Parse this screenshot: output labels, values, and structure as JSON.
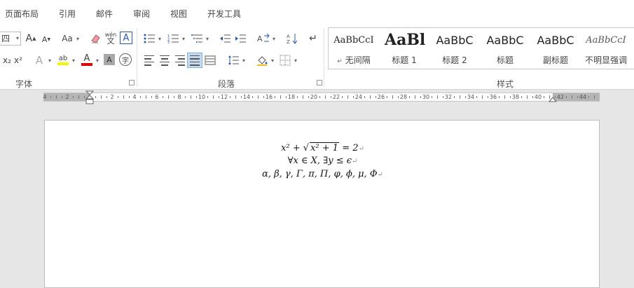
{
  "menu": {
    "tabs": [
      "页面布局",
      "引用",
      "邮件",
      "审阅",
      "视图",
      "开发工具"
    ]
  },
  "ribbon": {
    "font_group": {
      "label": "字体",
      "font_size": "四",
      "buttons": {
        "grow_font": "A",
        "shrink_font": "A",
        "change_case": "Aa",
        "phonetic": "wén",
        "phonetic_char": "文",
        "char_border": "A",
        "subscript": "x₂",
        "superscript": "x²",
        "text_effect": "A",
        "highlight": "ab",
        "font_color": "A",
        "char_shading": "A",
        "enclose_char": "字"
      }
    },
    "paragraph_group": {
      "label": "段落"
    },
    "styles_group": {
      "label": "样式",
      "items": [
        {
          "sample": "AaBbCcI",
          "name": "无间隔",
          "prefix": "↵"
        },
        {
          "sample": "AaBl",
          "name": "标题 1"
        },
        {
          "sample": "AaBbC",
          "name": "标题 2"
        },
        {
          "sample": "AaBbC",
          "name": "标题"
        },
        {
          "sample": "AaBbC",
          "name": "副标题"
        },
        {
          "sample": "AaBbCcI",
          "name": "不明显强调"
        }
      ]
    }
  },
  "ruler": {
    "labels": [
      "4",
      "2",
      "2",
      "4",
      "6",
      "8",
      "10",
      "12",
      "14",
      "16",
      "18",
      "20",
      "22",
      "24",
      "26",
      "28",
      "30",
      "32",
      "34",
      "36",
      "38",
      "40",
      "42",
      "44"
    ]
  },
  "document": {
    "lines": [
      {
        "parts": [
          "x² + ",
          "x² + 1",
          " = 2"
        ]
      },
      {
        "text": "∀x ∈ X, ∃y ≤ ϵ"
      },
      {
        "text": "α, β, γ, Γ, π, Π, φ, ϕ, μ, Φ"
      }
    ],
    "paragraph_mark": "↵"
  }
}
